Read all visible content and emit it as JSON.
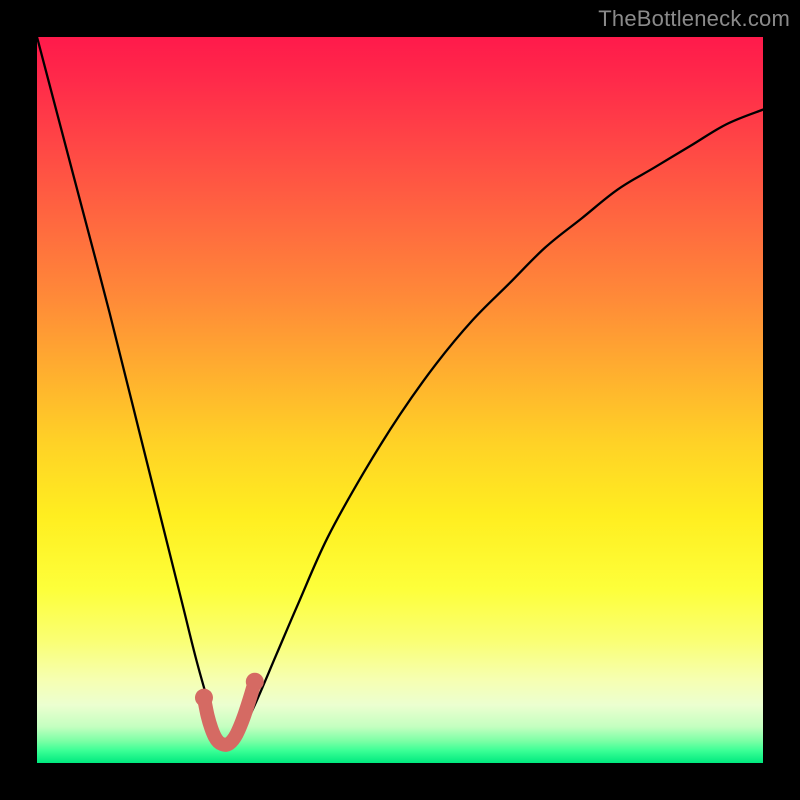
{
  "watermark": "TheBottleneck.com",
  "chart_data": {
    "type": "line",
    "title": "",
    "xlabel": "",
    "ylabel": "",
    "xlim": [
      0,
      100
    ],
    "ylim": [
      0,
      100
    ],
    "grid": false,
    "series": [
      {
        "name": "bottleneck-curve",
        "x": [
          0,
          5,
          10,
          14,
          17,
          20,
          22,
          24,
          25,
          26,
          27,
          28,
          30,
          33,
          36,
          40,
          45,
          50,
          55,
          60,
          65,
          70,
          75,
          80,
          85,
          90,
          95,
          100
        ],
        "values": [
          100,
          81,
          62,
          46,
          34,
          22,
          14,
          7,
          4,
          3,
          3,
          4,
          8,
          15,
          22,
          31,
          40,
          48,
          55,
          61,
          66,
          71,
          75,
          79,
          82,
          85,
          88,
          90
        ]
      },
      {
        "name": "valley-marker",
        "x": [
          23.0,
          23.5,
          24.0,
          24.5,
          25.0,
          25.5,
          26.0,
          26.5,
          27.0,
          27.5,
          28.0,
          28.5,
          29.0,
          29.5,
          30.0
        ],
        "values": [
          9.0,
          6.5,
          4.8,
          3.6,
          2.9,
          2.6,
          2.5,
          2.7,
          3.2,
          4.0,
          5.1,
          6.4,
          7.9,
          9.5,
          11.2
        ]
      }
    ],
    "annotations": [
      {
        "text": "TheBottleneck.com",
        "pos": "top-right"
      }
    ]
  }
}
